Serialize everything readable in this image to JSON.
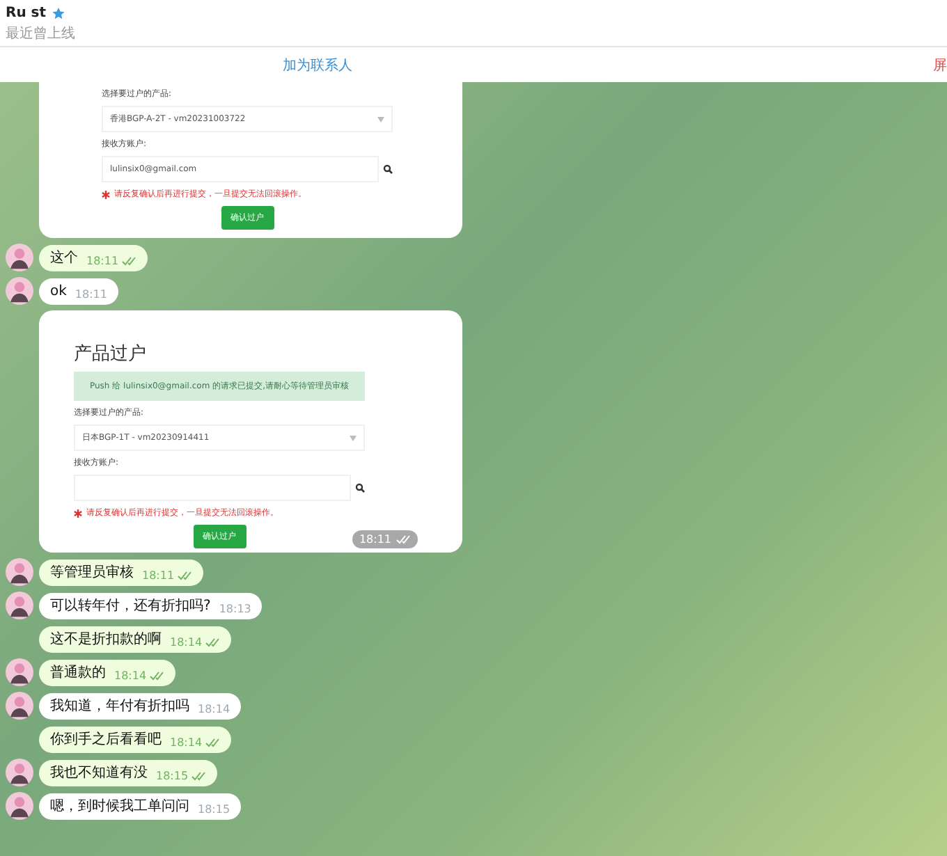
{
  "header": {
    "name": "Ru st",
    "verified": true,
    "status": "最近曾上线"
  },
  "actions": [
    {
      "label": "加为联系人",
      "kind": "add"
    },
    {
      "label": "屏",
      "kind": "block"
    }
  ],
  "messages": [
    {
      "kind": "screenshot",
      "avatar": false,
      "form": {
        "select_label": "选择要过户的产品:",
        "select_value": "香港BGP-A-2T - vm20231003722",
        "recipient_label": "接收方账户:",
        "recipient_value": "lulinsix0@gmail.com",
        "warning": "请反复确认后再进行提交，一旦提交无法回滚操作。",
        "button": "确认过户"
      }
    },
    {
      "kind": "text",
      "outgoing": true,
      "avatar": true,
      "text": "这个",
      "time": "18:11",
      "read": true
    },
    {
      "kind": "text",
      "outgoing": false,
      "avatar": true,
      "text": "ok",
      "time": "18:11"
    },
    {
      "kind": "screenshot",
      "avatar": false,
      "time": "18:11",
      "read": true,
      "form": {
        "title": "产品过户",
        "notice": "Push 给 lulinsix0@gmail.com 的请求已提交,请耐心等待管理员审核",
        "select_label": "选择要过户的产品:",
        "select_value": "日本BGP-1T - vm20230914411",
        "recipient_label": "接收方账户:",
        "warning": "请反复确认后再进行提交，一旦提交无法回滚操作。",
        "button": "确认过户"
      }
    },
    {
      "kind": "text",
      "outgoing": true,
      "avatar": true,
      "text": "等管理员审核",
      "time": "18:11",
      "read": true
    },
    {
      "kind": "text",
      "outgoing": false,
      "avatar": true,
      "text": "可以转年付，还有折扣吗?",
      "time": "18:13"
    },
    {
      "kind": "text",
      "outgoing": true,
      "avatar": false,
      "text": "这不是折扣款的啊",
      "time": "18:14",
      "read": true
    },
    {
      "kind": "text",
      "outgoing": true,
      "avatar": true,
      "text": "普通款的",
      "time": "18:14",
      "read": true
    },
    {
      "kind": "text",
      "outgoing": false,
      "avatar": true,
      "text": "我知道，年付有折扣吗",
      "time": "18:14"
    },
    {
      "kind": "text",
      "outgoing": true,
      "avatar": false,
      "text": "你到手之后看看吧",
      "time": "18:14",
      "read": true
    },
    {
      "kind": "text",
      "outgoing": true,
      "avatar": true,
      "text": "我也不知道有没",
      "time": "18:15",
      "read": true
    },
    {
      "kind": "text",
      "outgoing": false,
      "avatar": true,
      "text": "嗯，到时候我工单问问",
      "time": "18:15"
    }
  ]
}
